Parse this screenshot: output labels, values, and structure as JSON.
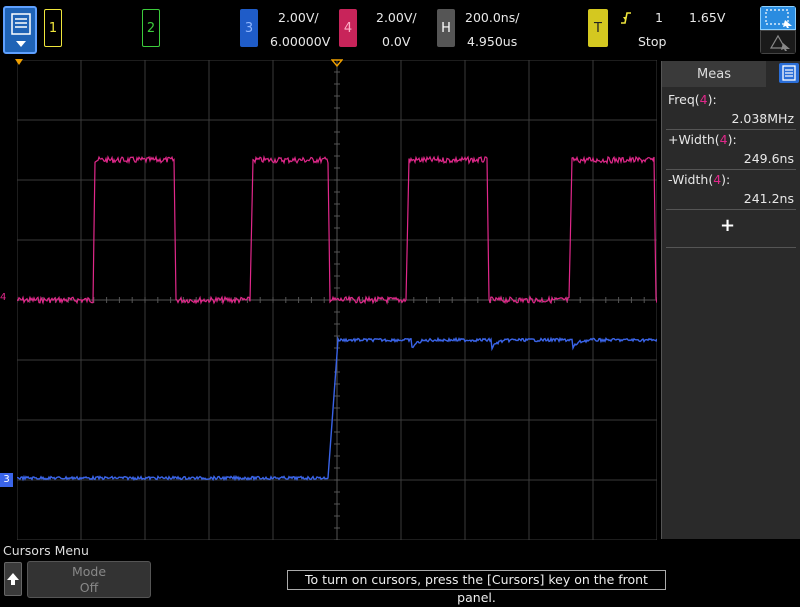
{
  "top": {
    "ch1_label": "1",
    "ch2_label": "2",
    "ch3_label": "3",
    "ch3_scale": "2.00V/",
    "ch3_offset": "6.00000V",
    "ch4_label": "4",
    "ch4_scale": "2.00V/",
    "ch4_offset": "0.0V",
    "h_label": "H",
    "h_scale": "200.0ns/",
    "h_delay": "4.950us",
    "t_label": "T",
    "trig_channel": "1",
    "trig_level": "1.65V",
    "run_state": "Stop"
  },
  "meas": {
    "title": "Meas",
    "items": [
      {
        "name": "Freq(",
        "ch": "4",
        "close": "):",
        "value": "2.038MHz"
      },
      {
        "name": "+Width(",
        "ch": "4",
        "close": "):",
        "value": "249.6ns"
      },
      {
        "name": "-Width(",
        "ch": "4",
        "close": "):",
        "value": "241.2ns"
      }
    ],
    "add_label": "+"
  },
  "bottom": {
    "menu_title": "Cursors Menu",
    "mode_label": "Mode",
    "mode_value": "Off",
    "hint": "To turn on cursors, press the [Cursors] key on the front panel."
  },
  "markers": {
    "ch4_marker": "4",
    "ch3_marker": "3"
  },
  "colors": {
    "ch3": "#3a64e8",
    "ch4": "#e0288a",
    "grid": "#3a3a3a",
    "trigger": "#f0a000"
  }
}
